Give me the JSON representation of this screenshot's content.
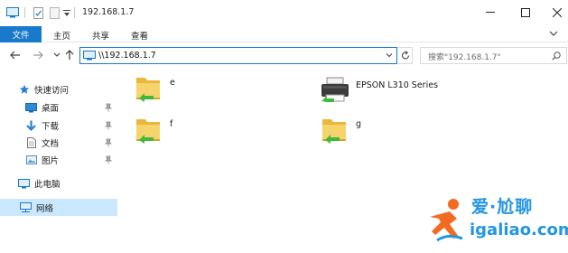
{
  "title_bar": {
    "path": "192.168.1.7"
  },
  "ribbon": {
    "tabs": [
      "文件",
      "主页",
      "共享",
      "查看"
    ]
  },
  "address_bar": {
    "path": "\\\\192.168.1.7"
  },
  "search": {
    "placeholder": "搜索\"192.168.1.7\""
  },
  "nav_pane": {
    "quick_access": "快速访问",
    "items": [
      "桌面",
      "下载",
      "文档",
      "图片"
    ],
    "this_pc": "此电脑",
    "network": "网络"
  },
  "content": {
    "items": [
      {
        "name": "e",
        "type": "folder"
      },
      {
        "name": "EPSON L310 Series",
        "type": "printer"
      },
      {
        "name": "f",
        "type": "folder"
      },
      {
        "name": "g",
        "type": "folder"
      }
    ]
  },
  "watermark": {
    "cn": "爱·尬聊",
    "en": "igaliao.com"
  },
  "colors": {
    "accent": "#1979ca",
    "selection": "#cce8ff",
    "watermark": "#2496e0",
    "folder": "#f1c34c",
    "share_arrow": "#42b83a"
  }
}
